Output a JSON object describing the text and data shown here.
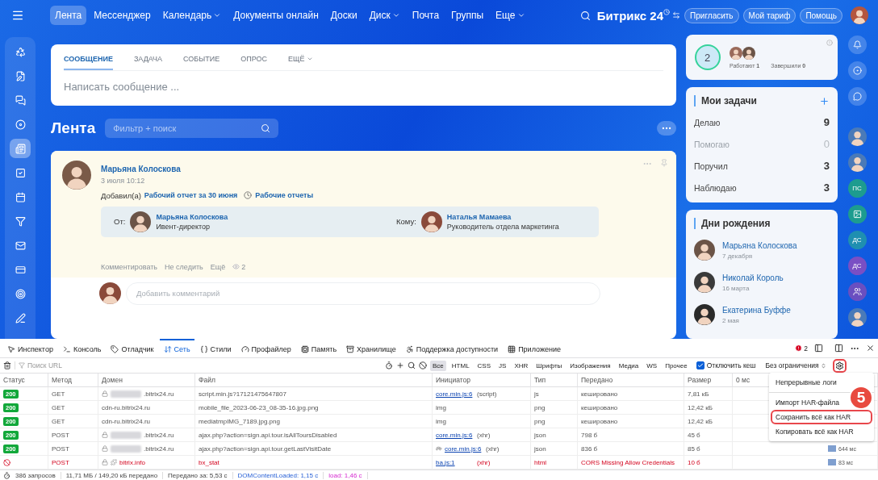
{
  "nav": {
    "items": [
      {
        "label": "Лента",
        "selected": true,
        "dropdown": false
      },
      {
        "label": "Мессенджер",
        "selected": false,
        "dropdown": false
      },
      {
        "label": "Календарь",
        "selected": false,
        "dropdown": true
      },
      {
        "label": "Документы онлайн",
        "selected": false,
        "dropdown": false
      },
      {
        "label": "Доски",
        "selected": false,
        "dropdown": false
      },
      {
        "label": "Диск",
        "selected": false,
        "dropdown": true
      },
      {
        "label": "Почта",
        "selected": false,
        "dropdown": false
      },
      {
        "label": "Группы",
        "selected": false,
        "dropdown": false
      },
      {
        "label": "Еще",
        "selected": false,
        "dropdown": true
      }
    ],
    "logo": "Битрикс",
    "logo_suffix": "24",
    "buttons": [
      "Пригласить",
      "Мой тариф",
      "Помощь"
    ]
  },
  "left_rail": {
    "items": [
      {
        "selected": false
      },
      {
        "selected": false
      },
      {
        "selected": false
      },
      {
        "selected": false
      },
      {
        "selected": true
      },
      {
        "selected": false
      },
      {
        "selected": false
      },
      {
        "selected": false
      },
      {
        "selected": false
      },
      {
        "selected": false
      },
      {
        "selected": false
      },
      {
        "selected": false
      }
    ]
  },
  "composer": {
    "tabs": [
      {
        "label": "СООБЩЕНИЕ",
        "selected": true,
        "dropdown": false
      },
      {
        "label": "ЗАДАЧА",
        "selected": false,
        "dropdown": false
      },
      {
        "label": "СОБЫТИЕ",
        "selected": false,
        "dropdown": false
      },
      {
        "label": "ОПРОС",
        "selected": false,
        "dropdown": false
      },
      {
        "label": "ЕЩЁ",
        "selected": false,
        "dropdown": true
      }
    ],
    "placeholder": "Написать сообщение ..."
  },
  "feed": {
    "title": "Лента",
    "filter_placeholder": "Фильтр + поиск"
  },
  "post": {
    "author": "Марьяна Колоскова",
    "time": "3 июля 10:12",
    "added_prefix": "Добавил(а)",
    "report_link": "Рабочий отчет за 30 июня",
    "category": "Рабочие отчеты",
    "from": {
      "label": "От:",
      "name": "Марьяна Колоскова",
      "role": "Ивент-директор"
    },
    "to": {
      "label": "Кому:",
      "name": "Наталья Мамаева",
      "role": "Руководитель отдела маркетинга"
    },
    "actions": [
      "Комментировать",
      "Не следить",
      "Ещё"
    ],
    "views": "2",
    "comment_placeholder": "Добавить комментарий"
  },
  "status_widget": {
    "count": "2",
    "working": "Работают **1**",
    "finished": "Завершили **0**"
  },
  "tasks": {
    "title": "Мои задачи",
    "rows": [
      {
        "label": "Делаю",
        "count": "9",
        "muted": false
      },
      {
        "label": "Помогаю",
        "count": "0",
        "muted": true
      },
      {
        "label": "Поручил",
        "count": "3",
        "muted": false
      },
      {
        "label": "Наблюдаю",
        "count": "3",
        "muted": false
      }
    ]
  },
  "birthdays": {
    "title": "Дни рождения",
    "people": [
      {
        "name": "Марьяна Колоскова",
        "date": "7 декабря"
      },
      {
        "name": "Николай Король",
        "date": "16 марта"
      },
      {
        "name": "Екатерина Буффе",
        "date": "2 мая"
      }
    ]
  },
  "right_rail": {
    "items": [
      {
        "kind": "button"
      },
      {
        "kind": "button"
      },
      {
        "kind": "button"
      },
      {
        "kind": "photo"
      },
      {
        "kind": "photo"
      },
      {
        "kind": "initials",
        "text": "ПС",
        "color": "#1d9c8f"
      },
      {
        "kind": "glyph",
        "color": "#1d9c8f"
      },
      {
        "kind": "initials",
        "text": "ДС",
        "color": "#1f8fb0"
      },
      {
        "kind": "initials",
        "text": "ДС",
        "color": "#7a4fc4"
      },
      {
        "kind": "glyph",
        "color": "#6a4fc0"
      },
      {
        "kind": "photo"
      }
    ]
  },
  "devtools": {
    "tabs": [
      {
        "label": "Инспектор",
        "selected": false
      },
      {
        "label": "Консоль",
        "selected": false
      },
      {
        "label": "Отладчик",
        "selected": false
      },
      {
        "label": "Сеть",
        "selected": true
      },
      {
        "label": "Стили",
        "selected": false
      },
      {
        "label": "Профайлер",
        "selected": false
      },
      {
        "label": "Память",
        "selected": false
      },
      {
        "label": "Хранилище",
        "selected": false
      },
      {
        "label": "Поддержка доступности",
        "selected": false
      },
      {
        "label": "Приложение",
        "selected": false
      }
    ],
    "error_count": "2",
    "filter_placeholder": "Поиск URL",
    "type_filters": [
      {
        "label": "Все",
        "selected": true
      },
      {
        "label": "HTML",
        "selected": false
      },
      {
        "label": "CSS",
        "selected": false
      },
      {
        "label": "JS",
        "selected": false
      },
      {
        "label": "XHR",
        "selected": false
      },
      {
        "label": "Шрифты",
        "selected": false
      },
      {
        "label": "Изображения",
        "selected": false
      },
      {
        "label": "Медиа",
        "selected": false
      },
      {
        "label": "WS",
        "selected": false
      },
      {
        "label": "Прочее",
        "selected": false
      }
    ],
    "disable_cache": {
      "label": "Отключить кеш",
      "checked": true
    },
    "throttling": "Без ограничения",
    "columns": [
      "Статус",
      "Метод",
      "Домен",
      "Файл",
      "Инициатор",
      "Тип",
      "Передано",
      "Размер",
      "0 мс"
    ],
    "rows": [
      {
        "kind": "ok",
        "status": "200",
        "method": "GET",
        "secure": true,
        "masked": true,
        "tracker": false,
        "domain": ".bitrix24.ru",
        "file": "script.min.js?17121475647807",
        "slow": false,
        "initiator_link": "core.min.js:6",
        "initiator_type": "(script)",
        "type": "js",
        "transferred": "кешировано",
        "size": "7,81 кБ"
      },
      {
        "kind": "ok",
        "status": "200",
        "method": "GET",
        "secure": false,
        "masked": false,
        "tracker": false,
        "domain": "cdn-ru.bitrix24.ru",
        "file": "mobile_file_2023-06-23_08-35-16.jpg.png",
        "slow": false,
        "initiator_type": "img",
        "type": "png",
        "transferred": "кешировано",
        "size": "12,42 кБ"
      },
      {
        "kind": "ok",
        "status": "200",
        "method": "GET",
        "secure": false,
        "masked": false,
        "tracker": false,
        "domain": "cdn-ru.bitrix24.ru",
        "file": "mediatmpIMG_7189.jpg.png",
        "slow": false,
        "initiator_type": "img",
        "type": "png",
        "transferred": "кешировано",
        "size": "12,42 кБ"
      },
      {
        "kind": "ok",
        "status": "200",
        "method": "POST",
        "secure": true,
        "masked": true,
        "tracker": false,
        "domain": ".bitrix24.ru",
        "file": "ajax.php?action=sign.api.tour.isAllToursDisabled",
        "slow": false,
        "initiator_link": "core.min.js:6",
        "initiator_type": "(xhr)",
        "type": "json",
        "transferred": "798 б",
        "size": "45 б"
      },
      {
        "kind": "ok",
        "status": "200",
        "method": "POST",
        "secure": true,
        "masked": true,
        "tracker": false,
        "domain": ".bitrix24.ru",
        "file": "ajax.php?action=sign.api.tour.getLastVisitDate",
        "slow": true,
        "initiator_link": "core.min.js:6",
        "initiator_type": "(xhr)",
        "type": "json",
        "transferred": "836 б",
        "size": "85 б",
        "timing": "644 мс"
      },
      {
        "kind": "blocked",
        "method": "POST",
        "secure": true,
        "masked": false,
        "tracker": true,
        "domain": "bitrix.info",
        "file": "bx_stat",
        "slow": false,
        "initiator_link": "ba.js:1",
        "initiator_type": "(xhr)",
        "type": "html",
        "transferred": "CORS Missing Allow Credentials",
        "size": "10 б",
        "timing": "83 мс"
      }
    ]
  },
  "menu": {
    "items": [
      {
        "label": "Непрерывные логи",
        "highlighted": false
      },
      {
        "label": "Импорт HAR-файла",
        "highlighted": false
      },
      {
        "label": "Сохранить всё как HAR",
        "highlighted": true
      },
      {
        "label": "Копировать всё как HAR",
        "highlighted": false
      }
    ]
  },
  "step_badge": "5",
  "summary": [
    {
      "text": "386 запросов",
      "kind": "plain"
    },
    {
      "text": "11,71 МБ / 149,20 кБ передано",
      "kind": "plain"
    },
    {
      "text": "Передано за: 5,53 с",
      "kind": "plain"
    },
    {
      "text": "DOMContentLoaded: 1,15 с",
      "kind": "dom"
    },
    {
      "text": "load: 1,46 с",
      "kind": "load"
    }
  ]
}
